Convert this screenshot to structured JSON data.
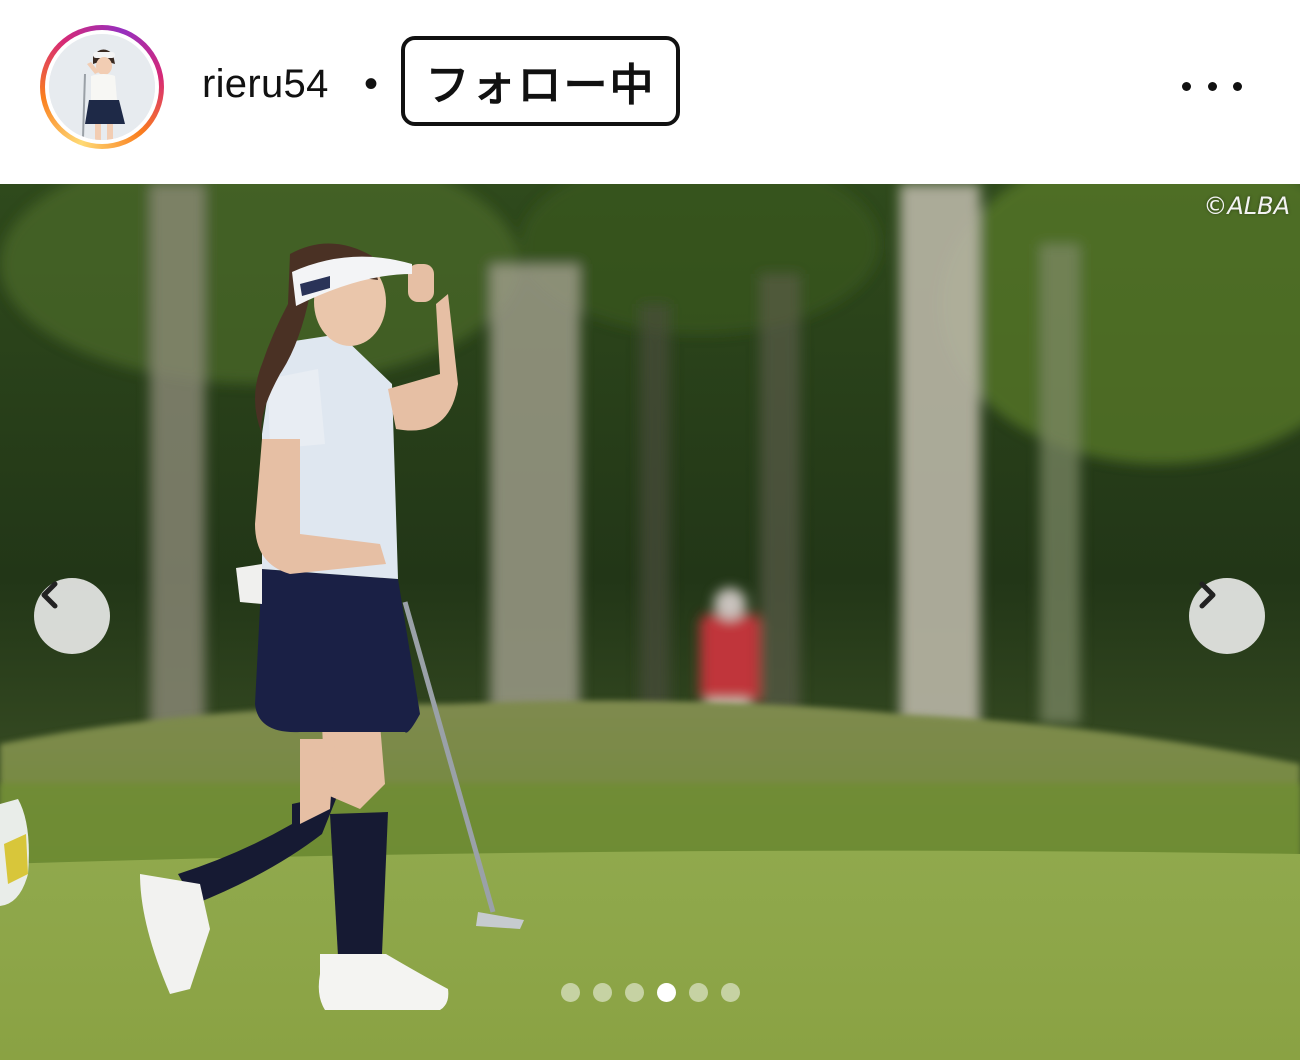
{
  "post_header": {
    "username": "rieru54",
    "separator": "•",
    "follow_button_label": "フォロー中",
    "more_icon": "more-horizontal-icon",
    "avatar_ring_colors": [
      "#feda75",
      "#fa7e1e",
      "#d62976",
      "#962fbf"
    ]
  },
  "media": {
    "credit": "©ALBA",
    "prev_icon": "chevron-left-icon",
    "next_icon": "chevron-right-icon",
    "carousel": {
      "total": 6,
      "current": 4
    }
  }
}
